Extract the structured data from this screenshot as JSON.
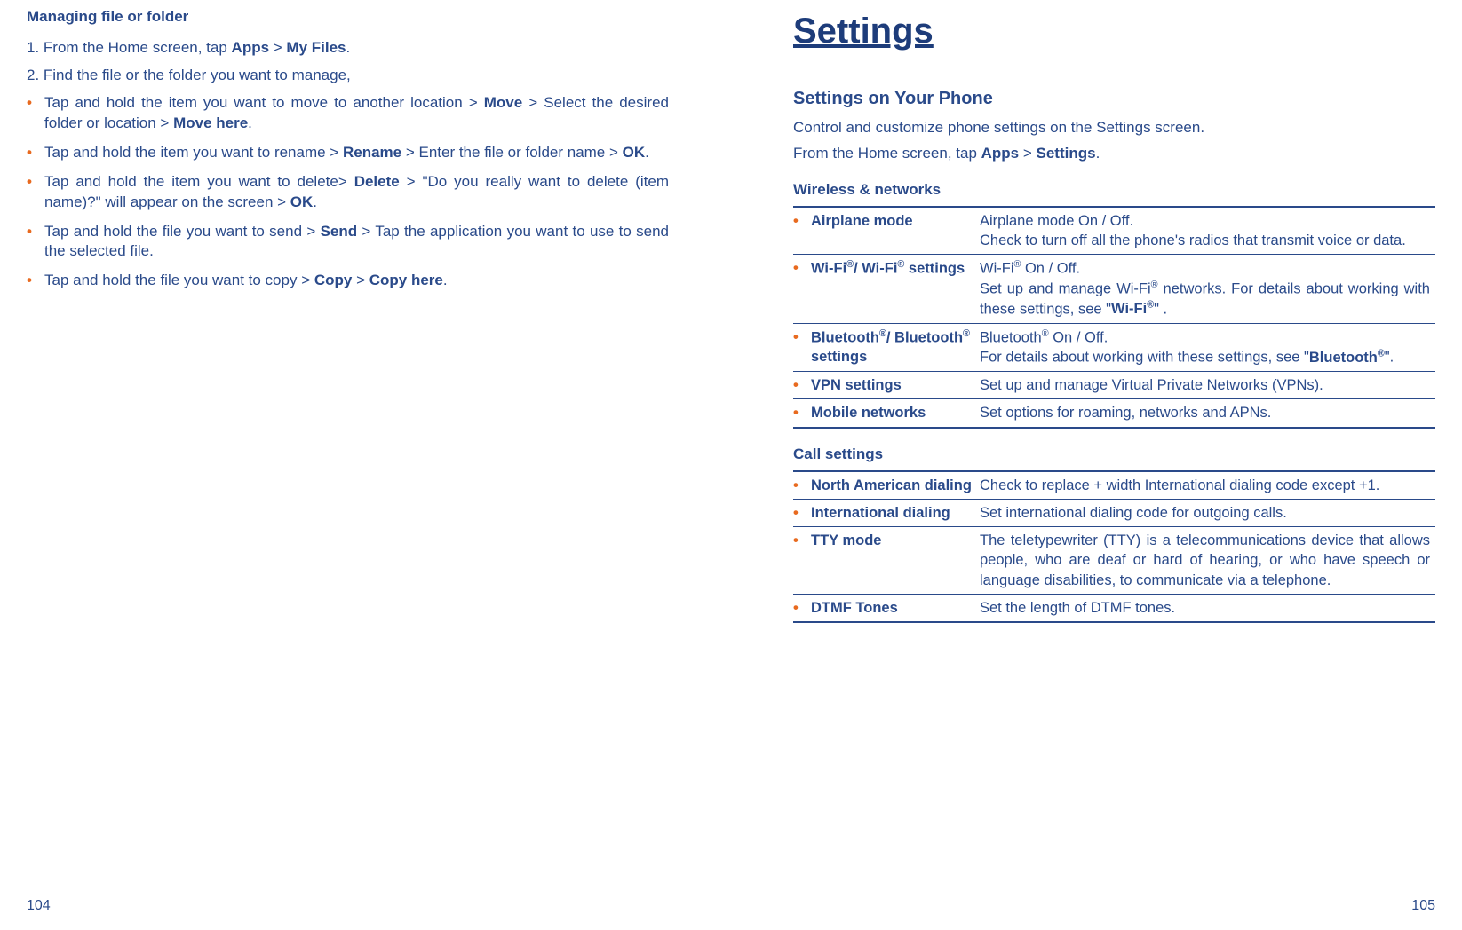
{
  "left": {
    "heading": "Managing file or folder",
    "step1_pre": "1. From the Home screen, tap ",
    "step1_b1": "Apps",
    "step1_mid": " > ",
    "step1_b2": "My Files",
    "step1_post": ".",
    "step2": "2. Find the file or the folder you want to manage,",
    "bullets": [
      {
        "pre": "Tap and hold the item you want to move to another location > ",
        "b1": "Move",
        "mid": " > Select the desired folder or location > ",
        "b2": "Move here",
        "post": "."
      },
      {
        "pre": "Tap and hold the item you want to rename > ",
        "b1": "Rename",
        "mid": " > Enter the file or folder name > ",
        "b2": "OK",
        "post": "."
      },
      {
        "pre": "Tap and hold the item you want to delete> ",
        "b1": "Delete",
        "mid": " > \"Do you really want to delete (item name)?\" will appear on the screen > ",
        "b2": "OK",
        "post": "."
      },
      {
        "pre": "Tap and hold the file you want to send > ",
        "b1": "Send",
        "mid": " > Tap the application you want to use to send the selected file.",
        "b2": "",
        "post": ""
      },
      {
        "pre": "Tap and hold the file you want to copy > ",
        "b1": "Copy",
        "mid": " > ",
        "b2": "Copy here",
        "post": "."
      }
    ],
    "pagenum": "104"
  },
  "right": {
    "title": "Settings",
    "section": "Settings on Your Phone",
    "p1": "Control and customize phone settings on the Settings screen.",
    "p2_pre": "From the Home screen, tap ",
    "p2_b1": "Apps",
    "p2_mid": " > ",
    "p2_b2": "Settings",
    "p2_post": ".",
    "sub1": "Wireless & networks",
    "wireless": [
      {
        "label": "Airplane mode",
        "desc": "Airplane mode On / Off.\nCheck to turn off all the phone's radios that transmit voice or data."
      },
      {
        "label": "Wi-Fi®/ Wi-Fi® settings",
        "desc": "Wi-Fi® On / Off.\nSet up and manage Wi-Fi® networks. For details about working with these settings, see \"Wi-Fi®\" .",
        "desc_b": "Wi-Fi®"
      },
      {
        "label": "Bluetooth®/ Bluetooth® settings",
        "desc": "Bluetooth® On / Off.\nFor details about working with these settings, see \"Bluetooth®\".",
        "desc_b": "Bluetooth®"
      },
      {
        "label": "VPN settings",
        "desc": "Set up and manage Virtual Private Networks (VPNs)."
      },
      {
        "label": "Mobile networks",
        "desc": "Set options for roaming, networks and APNs."
      }
    ],
    "sub2": "Call settings",
    "call": [
      {
        "label": "North American dialing",
        "desc": "Check to replace + width International dialing code except +1."
      },
      {
        "label": "International dialing",
        "desc": "Set international dialing code for outgoing calls."
      },
      {
        "label": "TTY mode",
        "desc": "The teletypewriter (TTY) is a telecommunications device that allows people, who are deaf or hard of hearing, or who have speech or language disabilities, to communicate via a telephone."
      },
      {
        "label": "DTMF Tones",
        "desc": "Set the length of DTMF tones."
      }
    ],
    "pagenum": "105"
  }
}
